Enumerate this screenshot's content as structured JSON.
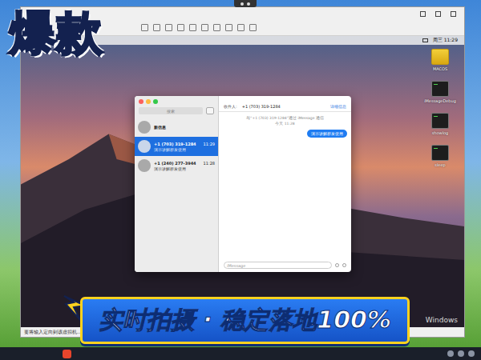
{
  "banner": {
    "title": "爆款"
  },
  "caption": {
    "text": "实时拍摄 · 稳定落地100%"
  },
  "vm": {
    "status_hint": "要将输入定向到该虚拟机...",
    "menubar": {
      "clock": "周三 11:29"
    },
    "desktop_icons": [
      {
        "label": "MACOS",
        "kind": "folder"
      },
      {
        "label": "iMessageDebug",
        "kind": "terminal"
      },
      {
        "label": "showlog",
        "kind": "terminal"
      },
      {
        "label": "sleep",
        "kind": "terminal"
      }
    ]
  },
  "messages": {
    "search": {
      "placeholder": "搜索"
    },
    "conversations": [
      {
        "name": "新信息",
        "selected": false
      },
      {
        "name": "+1 (703) 319-1284",
        "preview": "演示讲解群发使用",
        "time": "11:29",
        "selected": true
      },
      {
        "name": "+1 (240) 277-3944",
        "preview": "演示讲解群发使用",
        "time": "11:28",
        "selected": false
      }
    ],
    "header": {
      "to_label": "收件人:",
      "to": "+1 (703) 319-1284",
      "details": "详细信息"
    },
    "thread_info": "与“+1 (703) 319-1284”通过 iMessage 通信",
    "date": "今天 11:28",
    "bubbles": [
      {
        "text": "演示讲解群发使用",
        "outgoing": true
      }
    ],
    "input": {
      "placeholder": "iMessage"
    }
  },
  "watermark": "Windows"
}
